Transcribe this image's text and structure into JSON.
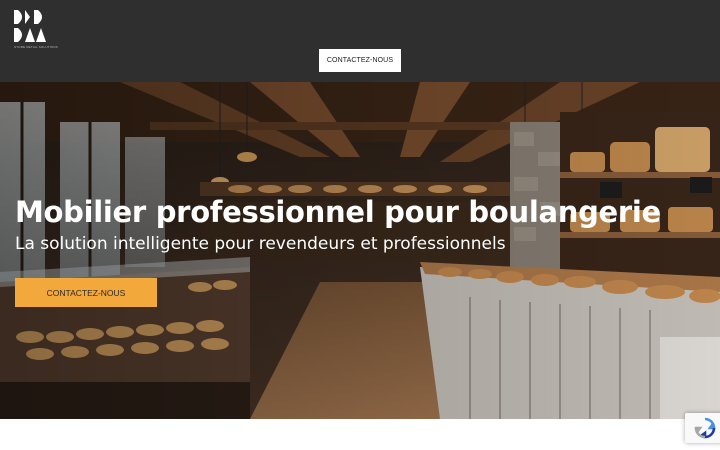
{
  "header": {
    "logo_text": "DKD",
    "logo_tagline": "STORE RETAIL SOLUTIONS",
    "contact_button": "CONTACTEZ-NOUS"
  },
  "hero": {
    "title": "Mobilier professionnel pour boulangerie",
    "subtitle": "La solution intelligente pour revendeurs et professionnels",
    "cta_button": "CONTACTEZ-NOUS",
    "background_image": "bakery-shop-interior"
  },
  "recaptcha": {
    "icon": "recaptcha-icon"
  },
  "colors": {
    "header_bg": "#2f2f2f",
    "cta_orange": "#f2a83b",
    "white": "#ffffff"
  }
}
